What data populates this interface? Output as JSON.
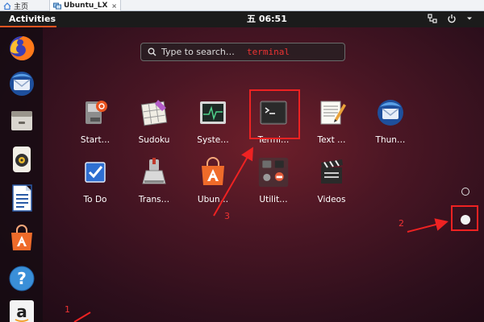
{
  "host_tabs": [
    {
      "label": "主页"
    },
    {
      "label": "Ubuntu_LX",
      "close": "×"
    }
  ],
  "topbar": {
    "activities": "Activities",
    "clock": "五 06:51"
  },
  "dock_items": [
    {
      "name": "firefox"
    },
    {
      "name": "thunderbird"
    },
    {
      "name": "files"
    },
    {
      "name": "rhythmbox"
    },
    {
      "name": "libreoffice-writer"
    },
    {
      "name": "ubuntu-software"
    },
    {
      "name": "help"
    },
    {
      "name": "amazon",
      "glyph": "a"
    }
  ],
  "search": {
    "placeholder": "Type to search…",
    "typed_annotation": "terminal"
  },
  "apps": [
    {
      "label": "Start…"
    },
    {
      "label": "Sudoku"
    },
    {
      "label": "Syste…"
    },
    {
      "label": "Termi…"
    },
    {
      "label": "Text …"
    },
    {
      "label": "Thun…"
    },
    {
      "label": "To Do"
    },
    {
      "label": "Trans…"
    },
    {
      "label": "Ubun…"
    },
    {
      "label": "Utilit…"
    },
    {
      "label": "Videos"
    }
  ],
  "annotations": {
    "n1": "1",
    "n2": "2",
    "n3": "3"
  },
  "colors": {
    "ubuntu_orange": "#e95420",
    "annotation_red": "#e22"
  }
}
